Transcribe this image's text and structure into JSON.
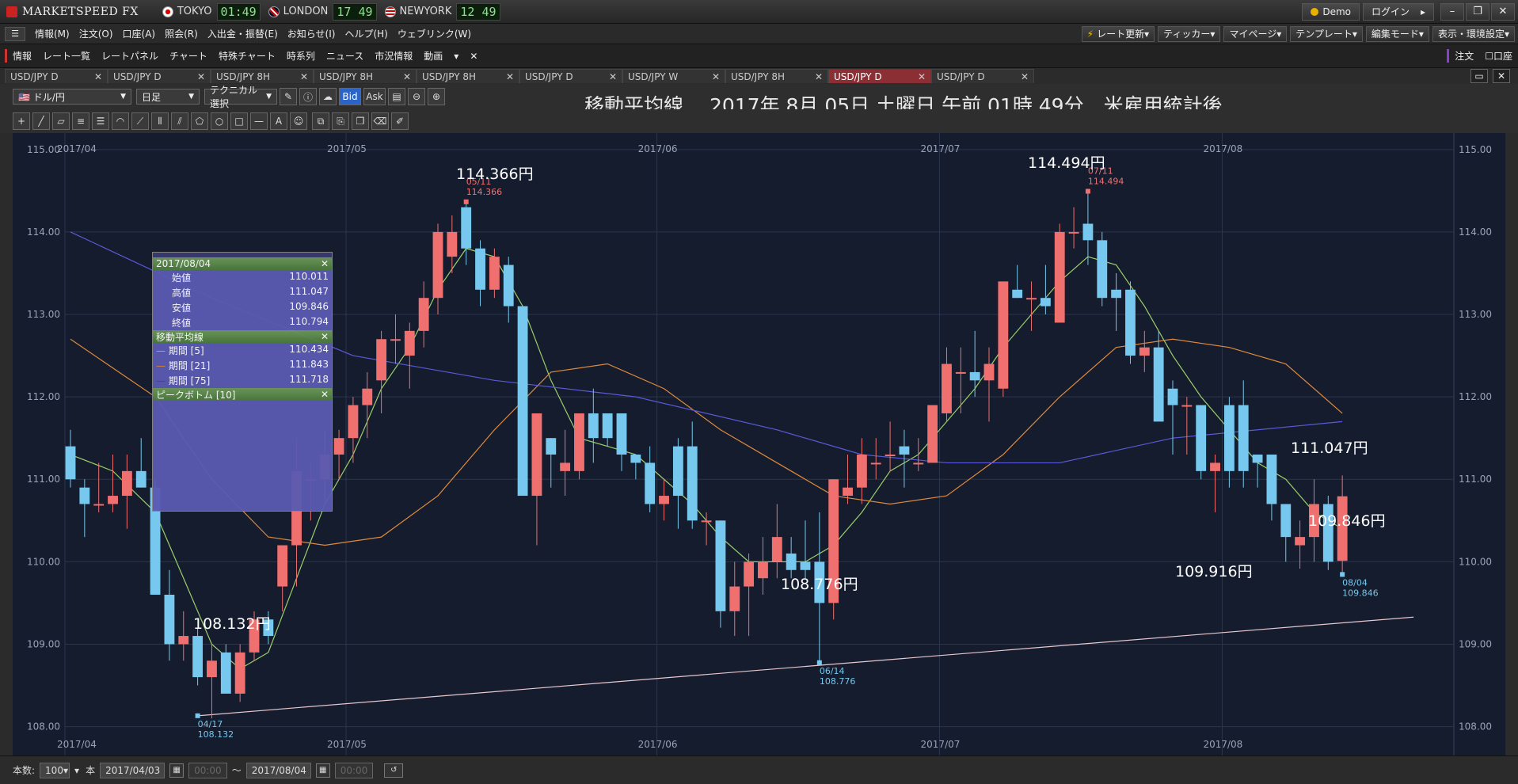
{
  "app": {
    "name": "MARKETSPEED FX",
    "clocks": [
      {
        "city": "TOKYO",
        "time": "01:49",
        "flag": "jp"
      },
      {
        "city": "LONDON",
        "time": "17 49",
        "flag": "uk"
      },
      {
        "city": "NEWYORK",
        "time": "12 49",
        "flag": "us"
      }
    ],
    "demo_label": "Demo",
    "login_label": "ログイン"
  },
  "menu": {
    "items": [
      "情報(M)",
      "注文(O)",
      "口座(A)",
      "照会(R)",
      "入出金・振替(E)",
      "お知らせ(I)",
      "ヘルプ(H)",
      "ウェブリンク(W)"
    ],
    "right": [
      "レート更新",
      "ティッカー",
      "マイページ",
      "テンプレート",
      "編集モード",
      "表示・環境設定"
    ]
  },
  "funcbar": {
    "items": [
      "情報",
      "レート一覧",
      "レートパネル",
      "チャート",
      "特殊チャート",
      "時系列",
      "ニュース",
      "市況情報",
      "動画"
    ],
    "right": [
      "注文",
      "口座"
    ]
  },
  "tabs": [
    {
      "label": "USD/JPY D",
      "active": false
    },
    {
      "label": "USD/JPY D",
      "active": false
    },
    {
      "label": "USD/JPY 8H",
      "active": false
    },
    {
      "label": "USD/JPY 8H",
      "active": false
    },
    {
      "label": "USD/JPY 8H",
      "active": false
    },
    {
      "label": "USD/JPY D",
      "active": false
    },
    {
      "label": "USD/JPY W",
      "active": false
    },
    {
      "label": "USD/JPY 8H",
      "active": false
    },
    {
      "label": "USD/JPY D",
      "active": true
    },
    {
      "label": "USD/JPY D",
      "active": false
    }
  ],
  "toolbar": {
    "pair": "ドル/円",
    "period": "日足",
    "technical": "テクニカル選択",
    "bid": "Bid",
    "ask": "Ask"
  },
  "title": "移動平均線　 2017年 8月 05日 土曜日 午前 01時 49分　米雇用統計後",
  "chart_data": {
    "type": "candlestick",
    "ylim": [
      107.65,
      115.2
    ],
    "yticks": [
      "115.00",
      "114.00",
      "113.00",
      "112.00",
      "111.00",
      "110.00",
      "109.00",
      "108.00"
    ],
    "month_labels": [
      "2017/04",
      "2017/05",
      "2017/06",
      "2017/07",
      "2017/08"
    ],
    "candles": [
      [
        111.4,
        111.6,
        110.9,
        111.0
      ],
      [
        110.9,
        111.0,
        110.3,
        110.7
      ],
      [
        110.7,
        111.2,
        110.6,
        110.7
      ],
      [
        110.7,
        111.3,
        110.6,
        110.8
      ],
      [
        110.8,
        111.3,
        110.4,
        111.1
      ],
      [
        111.1,
        111.5,
        110.9,
        110.9
      ],
      [
        110.9,
        111.0,
        109.9,
        109.6
      ],
      [
        109.6,
        109.9,
        108.8,
        109.0
      ],
      [
        109.0,
        109.4,
        108.8,
        109.1
      ],
      [
        109.1,
        109.2,
        108.5,
        108.6
      ],
      [
        108.6,
        109.0,
        108.1,
        108.8
      ],
      [
        108.9,
        109.0,
        108.5,
        108.4
      ],
      [
        108.4,
        109.0,
        108.3,
        108.9
      ],
      [
        108.9,
        109.4,
        108.8,
        109.3
      ],
      [
        109.3,
        109.4,
        109.0,
        109.1
      ],
      [
        109.7,
        110.0,
        109.4,
        110.2
      ],
      [
        110.2,
        111.5,
        109.7,
        111.1
      ],
      [
        111.0,
        111.2,
        110.5,
        111.0
      ],
      [
        111.0,
        111.6,
        110.7,
        111.3
      ],
      [
        111.3,
        111.6,
        111.0,
        111.5
      ],
      [
        111.5,
        112.0,
        111.2,
        111.9
      ],
      [
        111.9,
        112.3,
        111.5,
        112.1
      ],
      [
        112.2,
        112.8,
        111.8,
        112.7
      ],
      [
        112.7,
        113.0,
        112.4,
        112.7
      ],
      [
        112.5,
        112.9,
        112.1,
        112.8
      ],
      [
        112.8,
        113.4,
        112.6,
        113.2
      ],
      [
        113.2,
        114.1,
        113.0,
        114.0
      ],
      [
        113.7,
        114.2,
        113.5,
        114.0
      ],
      [
        114.3,
        114.366,
        113.6,
        113.8
      ],
      [
        113.8,
        113.9,
        113.1,
        113.3
      ],
      [
        113.3,
        113.8,
        113.2,
        113.7
      ],
      [
        113.6,
        113.7,
        112.9,
        113.1
      ],
      [
        113.1,
        113.1,
        111.0,
        110.8
      ],
      [
        110.8,
        111.6,
        110.2,
        111.8
      ],
      [
        111.5,
        111.5,
        110.9,
        111.3
      ],
      [
        111.1,
        111.6,
        110.8,
        111.2
      ],
      [
        111.1,
        111.8,
        111.0,
        111.8
      ],
      [
        111.8,
        112.1,
        111.2,
        111.5
      ],
      [
        111.8,
        111.8,
        111.4,
        111.5
      ],
      [
        111.8,
        111.8,
        111.1,
        111.3
      ],
      [
        111.3,
        111.3,
        111.0,
        111.2
      ],
      [
        111.2,
        111.4,
        110.6,
        110.7
      ],
      [
        110.7,
        111.0,
        110.5,
        110.8
      ],
      [
        111.4,
        111.5,
        110.4,
        110.8
      ],
      [
        111.4,
        111.7,
        110.4,
        110.5
      ],
      [
        110.5,
        110.6,
        110.2,
        110.5
      ],
      [
        110.5,
        110.5,
        109.2,
        109.4
      ],
      [
        109.4,
        110.0,
        109.1,
        109.7
      ],
      [
        109.7,
        110.1,
        109.1,
        110.0
      ],
      [
        109.8,
        110.3,
        109.6,
        110.0
      ],
      [
        110.0,
        110.7,
        109.8,
        110.3
      ],
      [
        110.1,
        110.3,
        109.8,
        109.9
      ],
      [
        110.0,
        110.5,
        109.8,
        109.9
      ],
      [
        110.0,
        110.6,
        108.776,
        109.5
      ],
      [
        109.5,
        111.0,
        109.3,
        111.0
      ],
      [
        110.8,
        111.3,
        110.7,
        110.9
      ],
      [
        110.9,
        111.5,
        110.7,
        111.3
      ],
      [
        111.2,
        111.5,
        111.0,
        111.2
      ],
      [
        111.3,
        111.7,
        111.1,
        111.3
      ],
      [
        111.4,
        111.6,
        110.9,
        111.3
      ],
      [
        111.2,
        111.5,
        111.1,
        111.2
      ],
      [
        111.2,
        111.9,
        111.2,
        111.9
      ],
      [
        111.8,
        112.6,
        111.7,
        112.4
      ],
      [
        112.3,
        112.6,
        111.8,
        112.3
      ],
      [
        112.3,
        112.8,
        112.0,
        112.2
      ],
      [
        112.2,
        112.6,
        111.7,
        112.4
      ],
      [
        112.1,
        113.4,
        112.0,
        113.4
      ],
      [
        113.3,
        113.6,
        113.2,
        113.2
      ],
      [
        113.2,
        113.4,
        112.8,
        113.2
      ],
      [
        113.2,
        113.6,
        113.0,
        113.1
      ],
      [
        112.9,
        114.1,
        112.9,
        114.0
      ],
      [
        114.0,
        114.3,
        113.8,
        114.0
      ],
      [
        114.1,
        114.494,
        113.6,
        113.9
      ],
      [
        113.9,
        114.0,
        113.1,
        113.2
      ],
      [
        113.3,
        113.5,
        112.8,
        113.2
      ],
      [
        113.3,
        113.4,
        112.4,
        112.5
      ],
      [
        112.5,
        112.8,
        112.3,
        112.6
      ],
      [
        112.6,
        112.8,
        111.9,
        111.7
      ],
      [
        112.1,
        112.2,
        111.3,
        111.9
      ],
      [
        111.9,
        112.0,
        111.3,
        111.9
      ],
      [
        111.9,
        111.9,
        111.0,
        111.1
      ],
      [
        111.1,
        111.3,
        110.6,
        111.2
      ],
      [
        111.9,
        112.0,
        110.9,
        111.1
      ],
      [
        111.9,
        112.2,
        110.9,
        111.1
      ],
      [
        111.3,
        111.3,
        110.9,
        111.2
      ],
      [
        111.3,
        111.3,
        110.5,
        110.7
      ],
      [
        110.7,
        110.7,
        110.0,
        110.3
      ],
      [
        110.2,
        110.5,
        109.916,
        110.3
      ],
      [
        110.3,
        111.0,
        110.0,
        110.7
      ],
      [
        110.7,
        110.8,
        109.9,
        110.0
      ],
      [
        110.011,
        111.047,
        109.846,
        110.794
      ]
    ],
    "ma_series": [
      {
        "name": "期間 [5]",
        "color": "#9ccf6a",
        "values": [
          [
            0,
            111.3
          ],
          [
            3,
            111.1
          ],
          [
            6,
            110.6
          ],
          [
            8,
            109.8
          ],
          [
            10,
            109.0
          ],
          [
            12,
            108.7
          ],
          [
            14,
            108.9
          ],
          [
            16,
            109.8
          ],
          [
            18,
            110.7
          ],
          [
            20,
            111.3
          ],
          [
            22,
            112.1
          ],
          [
            24,
            112.6
          ],
          [
            26,
            113.3
          ],
          [
            28,
            113.8
          ],
          [
            30,
            113.7
          ],
          [
            32,
            113.1
          ],
          [
            34,
            112.2
          ],
          [
            36,
            111.5
          ],
          [
            38,
            111.4
          ],
          [
            40,
            111.3
          ],
          [
            42,
            111.0
          ],
          [
            44,
            110.7
          ],
          [
            46,
            110.3
          ],
          [
            48,
            110.0
          ],
          [
            50,
            110.0
          ],
          [
            52,
            110.0
          ],
          [
            54,
            110.2
          ],
          [
            56,
            110.6
          ],
          [
            58,
            111.1
          ],
          [
            60,
            111.3
          ],
          [
            62,
            111.7
          ],
          [
            64,
            112.1
          ],
          [
            66,
            112.6
          ],
          [
            68,
            113.0
          ],
          [
            70,
            113.4
          ],
          [
            72,
            113.7
          ],
          [
            74,
            113.6
          ],
          [
            76,
            113.1
          ],
          [
            78,
            112.5
          ],
          [
            80,
            112.0
          ],
          [
            82,
            111.6
          ],
          [
            84,
            111.2
          ],
          [
            86,
            111.0
          ],
          [
            88,
            110.6
          ],
          [
            90,
            110.4
          ]
        ]
      },
      {
        "name": "期間 [21]",
        "color": "#e08a3a",
        "values": [
          [
            0,
            112.7
          ],
          [
            6,
            112.0
          ],
          [
            10,
            111.0
          ],
          [
            14,
            110.3
          ],
          [
            18,
            110.2
          ],
          [
            22,
            110.3
          ],
          [
            26,
            110.8
          ],
          [
            30,
            111.6
          ],
          [
            34,
            112.3
          ],
          [
            38,
            112.4
          ],
          [
            42,
            112.1
          ],
          [
            46,
            111.6
          ],
          [
            50,
            111.2
          ],
          [
            54,
            110.8
          ],
          [
            58,
            110.7
          ],
          [
            62,
            110.8
          ],
          [
            66,
            111.3
          ],
          [
            70,
            112.0
          ],
          [
            74,
            112.6
          ],
          [
            78,
            112.7
          ],
          [
            82,
            112.6
          ],
          [
            86,
            112.4
          ],
          [
            90,
            111.8
          ]
        ]
      },
      {
        "name": "期間 [75]",
        "color": "#5a5ad8",
        "values": [
          [
            0,
            114.0
          ],
          [
            10,
            113.2
          ],
          [
            20,
            112.5
          ],
          [
            30,
            112.2
          ],
          [
            40,
            112.0
          ],
          [
            50,
            111.6
          ],
          [
            56,
            111.3
          ],
          [
            62,
            111.2
          ],
          [
            70,
            111.2
          ],
          [
            78,
            111.5
          ],
          [
            84,
            111.6
          ],
          [
            90,
            111.7
          ]
        ]
      }
    ],
    "trendline": [
      [
        9,
        108.132
      ],
      [
        90,
        109.3
      ]
    ],
    "peak_labels": [
      {
        "index": 28,
        "price": 114.366,
        "date": "05/11",
        "value": "114.366",
        "big": "114.366円",
        "type": "peak"
      },
      {
        "index": 72,
        "price": 114.494,
        "date": "07/11",
        "value": "114.494",
        "big": "114.494円",
        "type": "peak"
      },
      {
        "index": 9,
        "price": 108.132,
        "date": "04/17",
        "value": "108.132",
        "big": "108.132円",
        "type": "bottom"
      },
      {
        "index": 53,
        "price": 108.776,
        "date": "06/14",
        "value": "108.776",
        "big": "108.776円",
        "type": "bottom"
      },
      {
        "index": 90,
        "price": 109.846,
        "date": "08/04",
        "value": "109.846",
        "big": "109.846円",
        "type": "bottom"
      }
    ],
    "annotations": [
      "111.047円",
      "109.916円"
    ]
  },
  "info_panel": {
    "date": "2017/08/04",
    "ohlc": [
      [
        "始値",
        "110.011"
      ],
      [
        "高値",
        "111.047"
      ],
      [
        "安値",
        "109.846"
      ],
      [
        "終値",
        "110.794"
      ]
    ],
    "ma_title": "移動平均線",
    "ma": [
      [
        "期間 [5]",
        "110.434"
      ],
      [
        "期間 [21]",
        "111.843"
      ],
      [
        "期間 [75]",
        "111.718"
      ]
    ],
    "peak_title": "ピークボトム [10]"
  },
  "footer": {
    "count_label": "本数:",
    "count_value": "100",
    "unit": "本",
    "from": "2017/04/03",
    "from_time": "00:00",
    "to": "2017/08/04",
    "to_time": "00:00",
    "sep": "～"
  }
}
